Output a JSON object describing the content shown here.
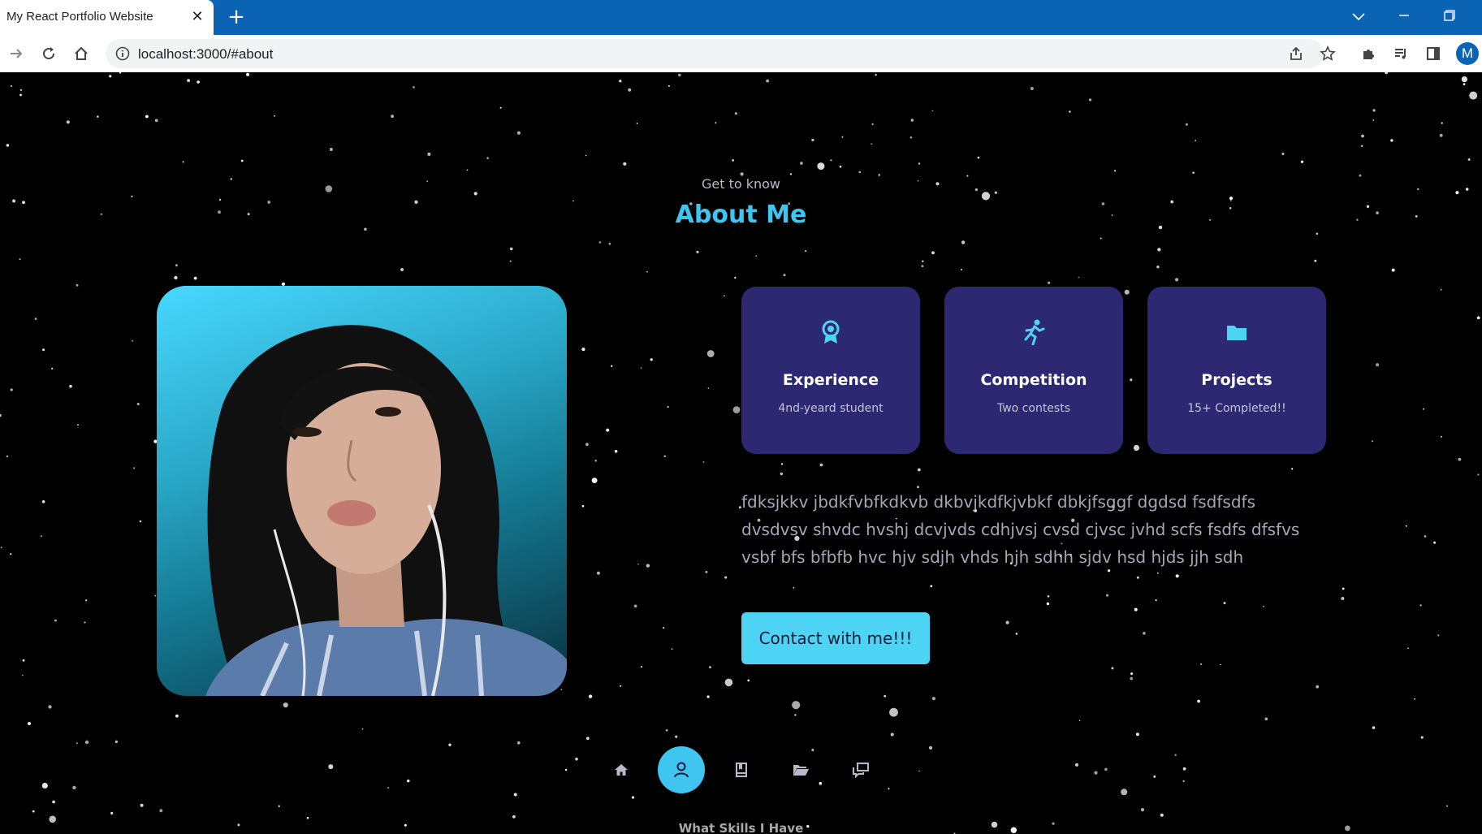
{
  "browser": {
    "tab_title": "My React Portfolio Website",
    "tab_close": "✕",
    "new_tab": "+",
    "address": "localhost:3000/#about",
    "profile_initial": "M",
    "window_controls": [
      "chevron-down-icon",
      "minimize-icon",
      "restore-icon"
    ]
  },
  "about": {
    "eyebrow": "Get to know",
    "title": "About Me",
    "cards": [
      {
        "icon": "award-icon",
        "title": "Experience",
        "subtitle": "4nd-yeard student"
      },
      {
        "icon": "running-icon",
        "title": "Competition",
        "subtitle": "Two contests"
      },
      {
        "icon": "folder-icon",
        "title": "Projects",
        "subtitle": "15+ Completed!!"
      }
    ],
    "description": "fdksjkkv jbdkfvbfkdkvb dkbvjkdfkjvbkf dbkjfsggf dgdsd fsdfsdfs dvsdvsv shvdc hvshj dcvjvds cdhjvsj cvsd cjvsc jvhd scfs fsdfs dfsfvs vsbf bfs bfbfb hvc hjv sdjh vhds hjh sdhh sjdv hsd hjds jjh sdh",
    "contact_button": "Contact with me!!!",
    "next_section_title": "What Skills I Have"
  },
  "nav": {
    "items": [
      "home-icon",
      "user-icon",
      "book-icon",
      "folder-open-icon",
      "messages-icon"
    ],
    "active_index": 1
  },
  "colors": {
    "accent": "#3fc6f0",
    "card_bg": "#2c2872",
    "tab_strip": "#0b64b3",
    "page_bg": "#000000"
  }
}
